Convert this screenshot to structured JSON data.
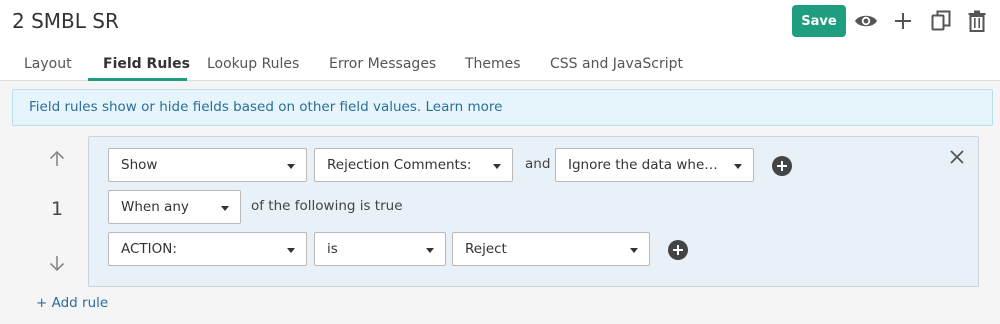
{
  "header": {
    "title": "2 SMBL SR",
    "save_label": "Save",
    "icons": [
      "eye-icon",
      "plus-icon",
      "copy-icon",
      "trash-icon"
    ]
  },
  "tabs": [
    {
      "label": "Layout",
      "active": false
    },
    {
      "label": "Field Rules",
      "active": true
    },
    {
      "label": "Lookup Rules",
      "active": false
    },
    {
      "label": "Error Messages",
      "active": false
    },
    {
      "label": "Themes",
      "active": false
    },
    {
      "label": "CSS and JavaScript",
      "active": false
    }
  ],
  "info": {
    "text": "Field rules show or hide fields based on other field values.",
    "link": "Learn more"
  },
  "rule": {
    "number": "1",
    "action_select": "Show",
    "field_select": "Rejection Comments:",
    "and_label": "and",
    "data_select": "Ignore the data when t...",
    "match_select": "When any",
    "match_suffix": "of the following is true",
    "condition": {
      "field": "ACTION:",
      "operator": "is",
      "value": "Reject"
    }
  },
  "add_rule_label": "+ Add rule",
  "colors": {
    "accent": "#1f9e7f",
    "info_bg": "#e6f4fb",
    "link": "#2a6f9a",
    "rule_bg": "#e8f0f8"
  }
}
